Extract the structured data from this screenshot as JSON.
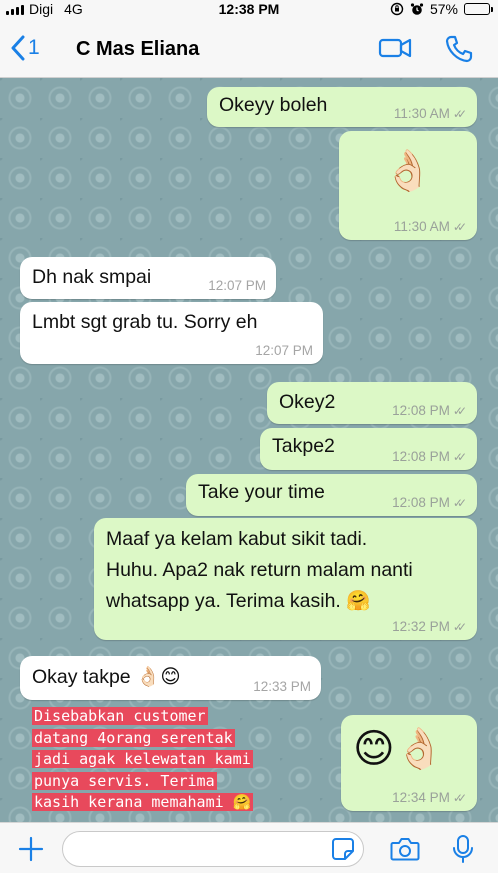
{
  "status_bar": {
    "carrier": "Digi",
    "network": "4G",
    "time": "12:38 PM",
    "battery": "57%",
    "battery_level": 0.57
  },
  "header": {
    "back_count": "1",
    "contact_name": "C Mas Eliana"
  },
  "messages": [
    {
      "direction": "out",
      "text": "Okeyy boleh",
      "time": "11:30 AM"
    },
    {
      "direction": "out",
      "emoji": "👌🏻",
      "time": "11:30 AM"
    },
    {
      "direction": "in",
      "text": "Dh nak smpai",
      "time": "12:07 PM"
    },
    {
      "direction": "in",
      "text": "Lmbt sgt grab tu. Sorry eh",
      "time": "12:07 PM"
    },
    {
      "direction": "out",
      "text": "Okey2",
      "time": "12:08 PM"
    },
    {
      "direction": "out",
      "text": "Takpe2",
      "time": "12:08 PM"
    },
    {
      "direction": "out",
      "text": "Take your time",
      "time": "12:08 PM"
    },
    {
      "direction": "out",
      "lines": [
        "Maaf ya kelam kabut sikit tadi.",
        "Huhu. Apa2 nak return malam nanti",
        "whatsapp ya. Terima kasih. 🤗"
      ],
      "time": "12:32 PM"
    },
    {
      "direction": "in",
      "text": "Okay takpe 👌🏻😊",
      "time": "12:33 PM"
    },
    {
      "direction": "out",
      "emoji": "😊👌🏻",
      "time": "12:34 PM"
    }
  ],
  "overlay_caption": {
    "lines": [
      "Disebabkan customer",
      "datang 4orang serentak",
      "jadi agak kelewatan kami",
      "punya servis. Terima",
      "kasih kerana memahami 🤗"
    ],
    "highlight_color": "#e8495c"
  },
  "input": {
    "value": "",
    "placeholder": ""
  },
  "colors": {
    "accent": "#1a80e6",
    "outgoing_bubble": "#dcf8c6",
    "incoming_bubble": "#ffffff",
    "wallpaper": "#86a6ab"
  },
  "icons": {
    "back": "chevron-left-icon",
    "video": "video-camera-icon",
    "call": "phone-icon",
    "add": "plus-icon",
    "sticker": "sticker-icon",
    "camera": "camera-icon",
    "mic": "microphone-icon",
    "read": "double-check-icon"
  }
}
